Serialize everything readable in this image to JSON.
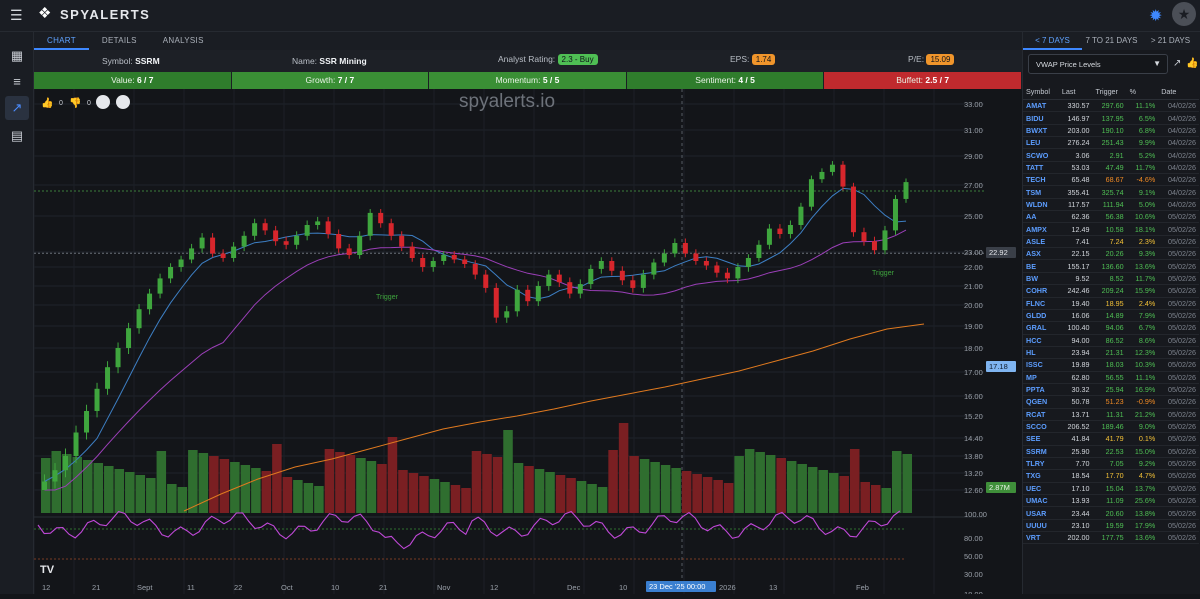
{
  "app": {
    "logo_text": "SPYALERTS"
  },
  "tabs": [
    "CHART",
    "DETAILS",
    "ANALYSIS"
  ],
  "info": {
    "symbol_label": "Symbol:",
    "symbol": "SSRM",
    "name_label": "Name:",
    "name": "SSR Mining",
    "rating_label": "Analyst Rating:",
    "rating": "2.3 - Buy",
    "eps_label": "EPS:",
    "eps": "1.74",
    "pe_label": "P/E:",
    "pe": "15.09"
  },
  "scores": [
    {
      "label": "Value:",
      "value": "6 / 7",
      "color": "#2f7d2c"
    },
    {
      "label": "Growth:",
      "value": "7 / 7",
      "color": "#3a8f35"
    },
    {
      "label": "Momentum:",
      "value": "5 / 5",
      "color": "#3a8f35"
    },
    {
      "label": "Sentiment:",
      "value": "4 / 5",
      "color": "#2f7d2c"
    },
    {
      "label": "Buffett:",
      "value": "2.5 / 7",
      "color": "#c02a2e"
    }
  ],
  "chart_toolbar": {
    "likes": "0",
    "dislikes": "0"
  },
  "watermark": "spyalerts.io",
  "chart_data": {
    "type": "candlestick",
    "symbol": "SSRM",
    "price_axis": [
      "33.00",
      "31.00",
      "29.00",
      "27.00",
      "25.00",
      "23.00",
      "22.00",
      "21.00",
      "20.00",
      "19.00",
      "18.00",
      "17.00",
      "16.00",
      "15.20",
      "14.40",
      "13.80",
      "13.20",
      "12.60"
    ],
    "price_axis_values": [
      33,
      31,
      29,
      27,
      25,
      23,
      22,
      21,
      20,
      19,
      18,
      17,
      16,
      15.2,
      14.4,
      13.8,
      13.2,
      12.6
    ],
    "oscillator_axis": [
      "100.00",
      "80.00",
      "50.00",
      "30.00",
      "18.00"
    ],
    "time_axis": [
      "12",
      "21",
      "Sept",
      "11",
      "22",
      "Oct",
      "10",
      "21",
      "Nov",
      "12",
      "Dec",
      "10",
      "2026",
      "13",
      "Feb"
    ],
    "last_price_label": "22.92",
    "last_price": 22.92,
    "marker_label": "17.18",
    "marker_value": 17.18,
    "volume_label": "2.87M",
    "crosshair_date": "23 Dec '25",
    "crosshair_time": "00:00",
    "annotations": [
      "Trigger",
      "Trigger"
    ],
    "lines": [
      "price",
      "short MA (blue)",
      "medium MA (purple)",
      "long MA (orange)"
    ],
    "close_series": [
      12.9,
      13.3,
      13.8,
      14.6,
      15.4,
      16.3,
      17.2,
      18.0,
      18.9,
      19.8,
      20.6,
      21.4,
      22.0,
      22.5,
      23.2,
      23.8,
      22.9,
      22.6,
      23.3,
      23.9,
      24.6,
      24.2,
      23.6,
      23.4,
      23.9,
      24.5,
      24.7,
      24.0,
      23.2,
      22.8,
      23.9,
      25.2,
      24.6,
      23.9,
      23.3,
      22.6,
      22.0,
      22.4,
      22.8,
      22.5,
      22.2,
      21.6,
      20.9,
      19.4,
      19.7,
      20.8,
      20.2,
      21.0,
      21.6,
      21.2,
      20.6,
      21.1,
      21.9,
      22.4,
      21.8,
      21.3,
      20.9,
      21.6,
      22.3,
      22.9,
      23.5,
      22.9,
      22.4,
      22.1,
      21.7,
      21.4,
      22.0,
      22.6,
      23.4,
      24.3,
      24.0,
      24.5,
      25.6,
      27.4,
      27.9,
      28.4,
      26.9,
      24.1,
      23.6,
      23.1,
      24.2,
      26.1,
      27.2
    ]
  },
  "watchlist": {
    "tabs": [
      "< 7 DAYS",
      "7 TO 21 DAYS",
      "> 21 DAYS"
    ],
    "select_label": "VWAP Price Levels",
    "headers": [
      "Symbol",
      "Last",
      "Trigger",
      "%",
      "Date"
    ],
    "rows": [
      [
        "AMAT",
        "330.57",
        "297.60",
        "11.1%",
        "04/02/26",
        "g"
      ],
      [
        "BIDU",
        "146.97",
        "137.95",
        "6.5%",
        "04/02/26",
        "g"
      ],
      [
        "BWXT",
        "203.00",
        "190.10",
        "6.8%",
        "04/02/26",
        "g"
      ],
      [
        "LEU",
        "276.24",
        "251.43",
        "9.9%",
        "04/02/26",
        "g"
      ],
      [
        "SCWO",
        "3.06",
        "2.91",
        "5.2%",
        "04/02/26",
        "g"
      ],
      [
        "TATT",
        "53.03",
        "47.49",
        "11.7%",
        "04/02/26",
        "g"
      ],
      [
        "TECH",
        "65.48",
        "68.67",
        "-4.6%",
        "04/02/26",
        "o"
      ],
      [
        "TSM",
        "355.41",
        "325.74",
        "9.1%",
        "04/02/26",
        "g"
      ],
      [
        "WLDN",
        "117.57",
        "111.94",
        "5.0%",
        "04/02/26",
        "g"
      ],
      [
        "AA",
        "62.36",
        "56.38",
        "10.6%",
        "05/02/26",
        "g"
      ],
      [
        "AMPX",
        "12.49",
        "10.58",
        "18.1%",
        "05/02/26",
        "g"
      ],
      [
        "ASLE",
        "7.41",
        "7.24",
        "2.3%",
        "05/02/26",
        "y"
      ],
      [
        "ASX",
        "22.15",
        "20.26",
        "9.3%",
        "05/02/26",
        "g"
      ],
      [
        "BE",
        "155.17",
        "136.60",
        "13.6%",
        "05/02/26",
        "g"
      ],
      [
        "BW",
        "9.52",
        "8.52",
        "11.7%",
        "05/02/26",
        "g"
      ],
      [
        "COHR",
        "242.46",
        "209.24",
        "15.9%",
        "05/02/26",
        "g"
      ],
      [
        "FLNC",
        "19.40",
        "18.95",
        "2.4%",
        "05/02/26",
        "y"
      ],
      [
        "GLDD",
        "16.06",
        "14.89",
        "7.9%",
        "05/02/26",
        "g"
      ],
      [
        "GRAL",
        "100.40",
        "94.06",
        "6.7%",
        "05/02/26",
        "g"
      ],
      [
        "HCC",
        "94.00",
        "86.52",
        "8.6%",
        "05/02/26",
        "g"
      ],
      [
        "HL",
        "23.94",
        "21.31",
        "12.3%",
        "05/02/26",
        "g"
      ],
      [
        "ISSC",
        "19.89",
        "18.03",
        "10.3%",
        "05/02/26",
        "g"
      ],
      [
        "MP",
        "62.80",
        "56.55",
        "11.1%",
        "05/02/26",
        "g"
      ],
      [
        "PPTA",
        "30.32",
        "25.94",
        "16.9%",
        "05/02/26",
        "g"
      ],
      [
        "QGEN",
        "50.78",
        "51.23",
        "-0.9%",
        "05/02/26",
        "o"
      ],
      [
        "RCAT",
        "13.71",
        "11.31",
        "21.2%",
        "05/02/26",
        "g"
      ],
      [
        "SCCO",
        "206.52",
        "189.46",
        "9.0%",
        "05/02/26",
        "g"
      ],
      [
        "SEE",
        "41.84",
        "41.79",
        "0.1%",
        "05/02/26",
        "y"
      ],
      [
        "SSRM",
        "25.90",
        "22.53",
        "15.0%",
        "05/02/26",
        "g"
      ],
      [
        "TLRY",
        "7.70",
        "7.05",
        "9.2%",
        "05/02/26",
        "g"
      ],
      [
        "TXG",
        "18.54",
        "17.70",
        "4.7%",
        "05/02/26",
        "y"
      ],
      [
        "UEC",
        "17.10",
        "15.04",
        "13.7%",
        "05/02/26",
        "g"
      ],
      [
        "UMAC",
        "13.93",
        "11.09",
        "25.6%",
        "05/02/26",
        "g"
      ],
      [
        "USAR",
        "23.44",
        "20.60",
        "13.8%",
        "05/02/26",
        "g"
      ],
      [
        "UUUU",
        "23.10",
        "19.59",
        "17.9%",
        "05/02/26",
        "g"
      ],
      [
        "VRT",
        "202.00",
        "177.75",
        "13.6%",
        "05/02/26",
        "g"
      ]
    ]
  }
}
